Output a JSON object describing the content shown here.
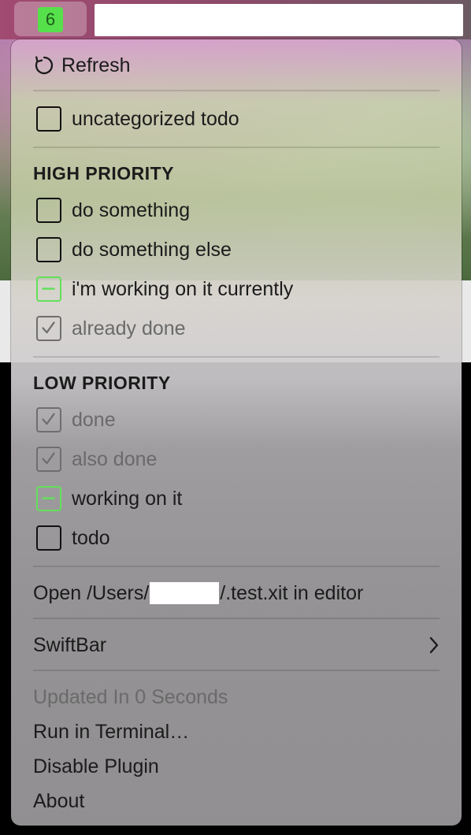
{
  "menubar": {
    "badge_count": "6"
  },
  "menu": {
    "refresh_label": "Refresh",
    "uncategorized": [
      {
        "label": "uncategorized todo",
        "state": "todo"
      }
    ],
    "sections": [
      {
        "title": "HIGH PRIORITY",
        "items": [
          {
            "label": "do something",
            "state": "todo"
          },
          {
            "label": "do something else",
            "state": "todo"
          },
          {
            "label": "i'm working on it currently",
            "state": "in-progress"
          },
          {
            "label": "already done",
            "state": "done"
          }
        ]
      },
      {
        "title": "LOW PRIORITY",
        "items": [
          {
            "label": "done",
            "state": "done"
          },
          {
            "label": "also done",
            "state": "done"
          },
          {
            "label": "working on it",
            "state": "in-progress"
          },
          {
            "label": "todo",
            "state": "todo"
          }
        ]
      }
    ],
    "open_file": {
      "prefix": "Open /Users/",
      "suffix": "/.test.xit in editor"
    },
    "swiftbar_label": "SwiftBar",
    "updated_label": "Updated In 0 Seconds",
    "run_terminal_label": "Run in Terminal…",
    "disable_plugin_label": "Disable Plugin",
    "about_label": "About"
  },
  "colors": {
    "badge": "#56e04b",
    "in_progress": "#62e05a",
    "done_text": "#6a6a6a"
  },
  "icons": [
    "refresh-icon",
    "checkbox-empty-icon",
    "checkbox-in-progress-icon",
    "checkbox-checked-icon",
    "chevron-right-icon"
  ]
}
